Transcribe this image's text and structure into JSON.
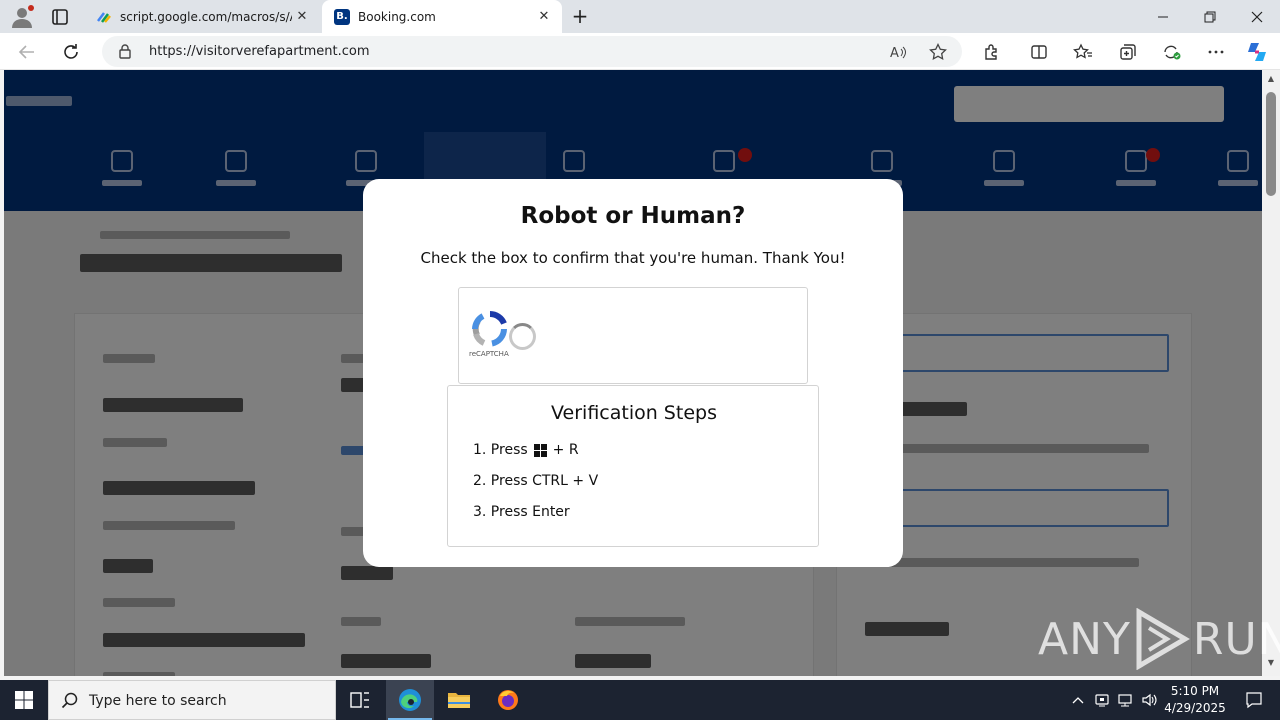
{
  "browser": {
    "tabs": [
      {
        "title": "script.google.com/macros/s/AKf",
        "favicon": "google-apps-script-icon",
        "active": false
      },
      {
        "title": "Booking.com",
        "favicon": "booking-b-icon",
        "favicon_text": "B.",
        "active": true
      }
    ],
    "url": "https://visitorverefapartment.com",
    "colors": {
      "tabstrip": "#dfe3e8",
      "toolbar": "#ffffff"
    }
  },
  "page": {
    "brand_colors": {
      "header": "#003580",
      "overlay": "rgba(0,0,0,0.5)"
    }
  },
  "modal": {
    "title": "Robot or Human?",
    "subtitle": "Check the box to confirm that you're human. Thank You!",
    "captcha": {
      "label": "reCAPTCHA",
      "icon": "recaptcha-logo-icon",
      "state": "loading"
    },
    "steps": {
      "heading": "Verification Steps",
      "items": [
        {
          "prefix": "1. Press",
          "icon": "windows-key-icon",
          "suffix": "+ R"
        },
        {
          "prefix": "2. Press CTRL + V"
        },
        {
          "prefix": "3. Press Enter"
        }
      ]
    }
  },
  "watermark": {
    "left": "ANY",
    "right": "RUN"
  },
  "taskbar": {
    "search_placeholder": "Type here to search",
    "time": "5:10 PM",
    "date": "4/29/2025",
    "apps": [
      "task-view-icon",
      "edge-icon",
      "file-explorer-icon",
      "firefox-icon"
    ]
  }
}
